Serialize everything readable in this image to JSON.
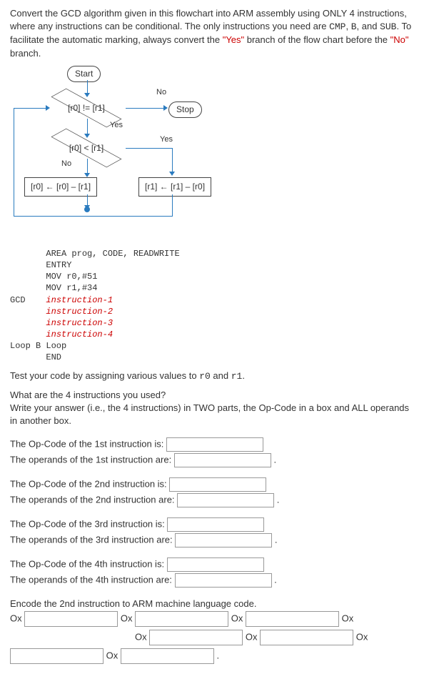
{
  "intro": {
    "part1": "Convert the GCD algorithm given in this flowchart into ARM assembly using ONLY 4 instructions, where any instructions can be conditional. The only instructions you need are ",
    "c1": "CMP",
    "c2": "B",
    "c3": "SUB",
    "mid": ". To facilitate the automatic marking, always convert the ",
    "yes": "\"Yes\"",
    "mid2": " branch of the flow chart before the ",
    "no": "\"No\"",
    "end": " branch."
  },
  "flow": {
    "start": "Start",
    "stop": "Stop",
    "d1": "[r0] != [r1]",
    "d2": "[r0] < [r1]",
    "b1": "[r0] ← [r0] – [r1]",
    "b2": "[r1] ← [r1]  – [r0]",
    "yes": "Yes",
    "no": "No"
  },
  "code": {
    "l1": "       AREA prog, CODE, READWRITE",
    "l2": "       ENTRY",
    "l3": "       MOV r0,#51",
    "l4": "       MOV r1,#34",
    "l5p": "GCD    ",
    "i1": "instruction-1",
    "i2": "instruction-2",
    "i3": "instruction-3",
    "i4": "instruction-4",
    "l9": "Loop B Loop",
    "l10": "       END"
  },
  "test_line": "Test your code by assigning various values to ",
  "test_r0": "r0",
  "test_and": " and ",
  "test_r1": "r1",
  "q_intro1": "What are the 4 instructions you used?",
  "q_intro2": "Write your answer (i.e., the 4 instructions) in TWO parts, the Op-Code in a box and ALL operands in another box.",
  "rows": {
    "op1": "The Op-Code of the 1st instruction is:",
    "opr1": "The operands of the 1st instruction are:",
    "op2": "The Op-Code of the 2nd instruction is:",
    "opr2": "The operands of the 2nd instruction are:",
    "op3": "The Op-Code of the 3rd instruction is:",
    "opr3": "The operands of the 3rd instruction are:",
    "op4": "The Op-Code of the 4th instruction is:",
    "opr4": "The operands of the 4th instruction are:"
  },
  "encode_label": "Encode the 2nd instruction to ARM machine language code.",
  "ox": "Ox",
  "period": "."
}
